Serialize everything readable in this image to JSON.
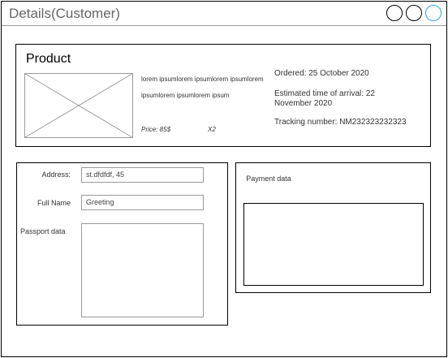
{
  "window": {
    "title": "Details(Customer)",
    "controls": [
      "circle-icon",
      "circle-icon",
      "circle-icon"
    ],
    "accent_color": "#29a8e0"
  },
  "product": {
    "heading": "Product",
    "image_icon": "image-placeholder-icon",
    "description_line1": "lorem ipsumlorem ipsumlorem ipsumlorem",
    "description_line2": "ipsumlorem ipsumlorem ipsum",
    "price": "Price: 85$",
    "quantity": "X2",
    "ordered": "Ordered: 25 October 2020",
    "eta": "Estimated time of arrival: 22 November 2020",
    "tracking": "Tracking number: NM232323232323"
  },
  "customer": {
    "address_label": "Address:",
    "address_value": "st.dfdfdf, 45",
    "name_label": "Full Name",
    "name_value": "Greeting",
    "passport_label": "Passport data",
    "passport_value": ""
  },
  "payment": {
    "label": "Payment data"
  }
}
